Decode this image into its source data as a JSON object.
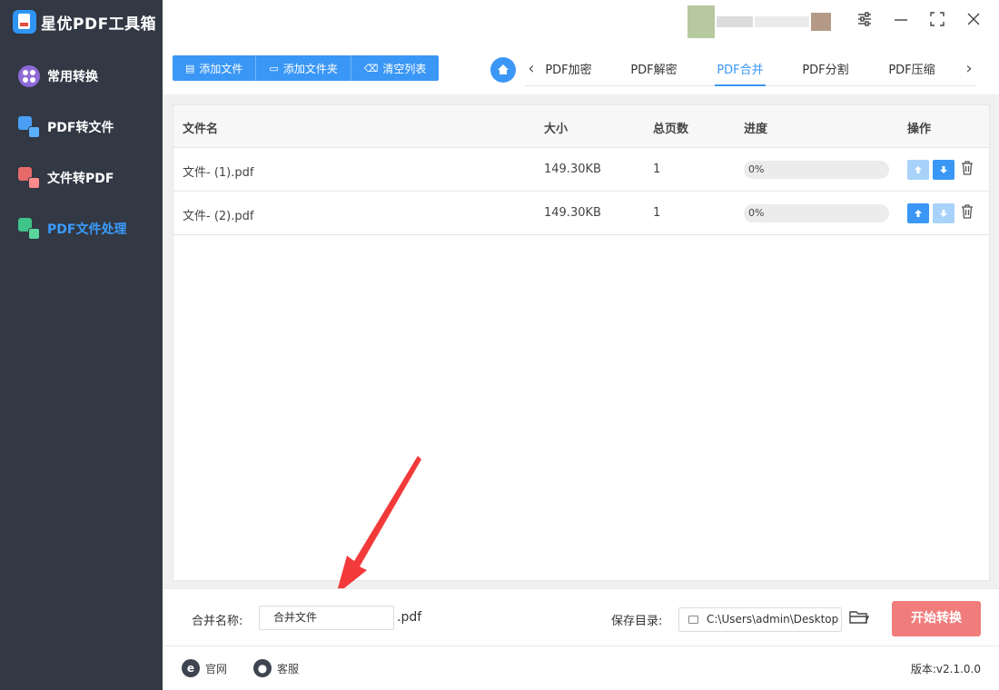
{
  "app": {
    "title": "星优PDF工具箱"
  },
  "sidebar": {
    "items": [
      {
        "label": "常用转换",
        "icon": "grid-circle-icon",
        "active": false
      },
      {
        "label": "PDF转文件",
        "icon": "pdf-to-file-icon",
        "active": false
      },
      {
        "label": "文件转PDF",
        "icon": "file-to-pdf-icon",
        "active": false
      },
      {
        "label": "PDF文件处理",
        "icon": "pdf-process-icon",
        "active": true
      }
    ]
  },
  "window": {
    "settings_icon": "sliders-icon",
    "minimize_icon": "minimize-icon",
    "maximize_icon": "maximize-icon",
    "close_icon": "close-icon"
  },
  "toolbar": {
    "add_file": "添加文件",
    "add_folder": "添加文件夹",
    "clear_list": "清空列表"
  },
  "tabs": {
    "items": [
      {
        "label": "PDF加密",
        "active": false
      },
      {
        "label": "PDF解密",
        "active": false
      },
      {
        "label": "PDF合并",
        "active": true
      },
      {
        "label": "PDF分割",
        "active": false
      },
      {
        "label": "PDF压缩",
        "active": false
      }
    ]
  },
  "table": {
    "columns": {
      "name": "文件名",
      "size": "大小",
      "pages": "总页数",
      "progress": "进度",
      "actions": "操作"
    },
    "rows": [
      {
        "name": "文件- (1).pdf",
        "size": "149.30KB",
        "pages": "1",
        "progress_text": "0%",
        "progress_value": 0
      },
      {
        "name": "文件- (2).pdf",
        "size": "149.30KB",
        "pages": "1",
        "progress_text": "0%",
        "progress_value": 0
      }
    ]
  },
  "bottom": {
    "merge_label": "合并名称:",
    "merge_value": "合并文件",
    "suffix": ".pdf",
    "save_label": "保存目录:",
    "save_path": "C:\\Users\\admin\\Desktop",
    "start_button": "开始转换"
  },
  "footer": {
    "website": "官网",
    "support": "客服",
    "version": "版本:v2.1.0.0"
  },
  "colors": {
    "sidebar_bg": "#323844",
    "accent": "#3a97f5",
    "start_button": "#f07c7c",
    "active_nav": "#3b9cff"
  }
}
